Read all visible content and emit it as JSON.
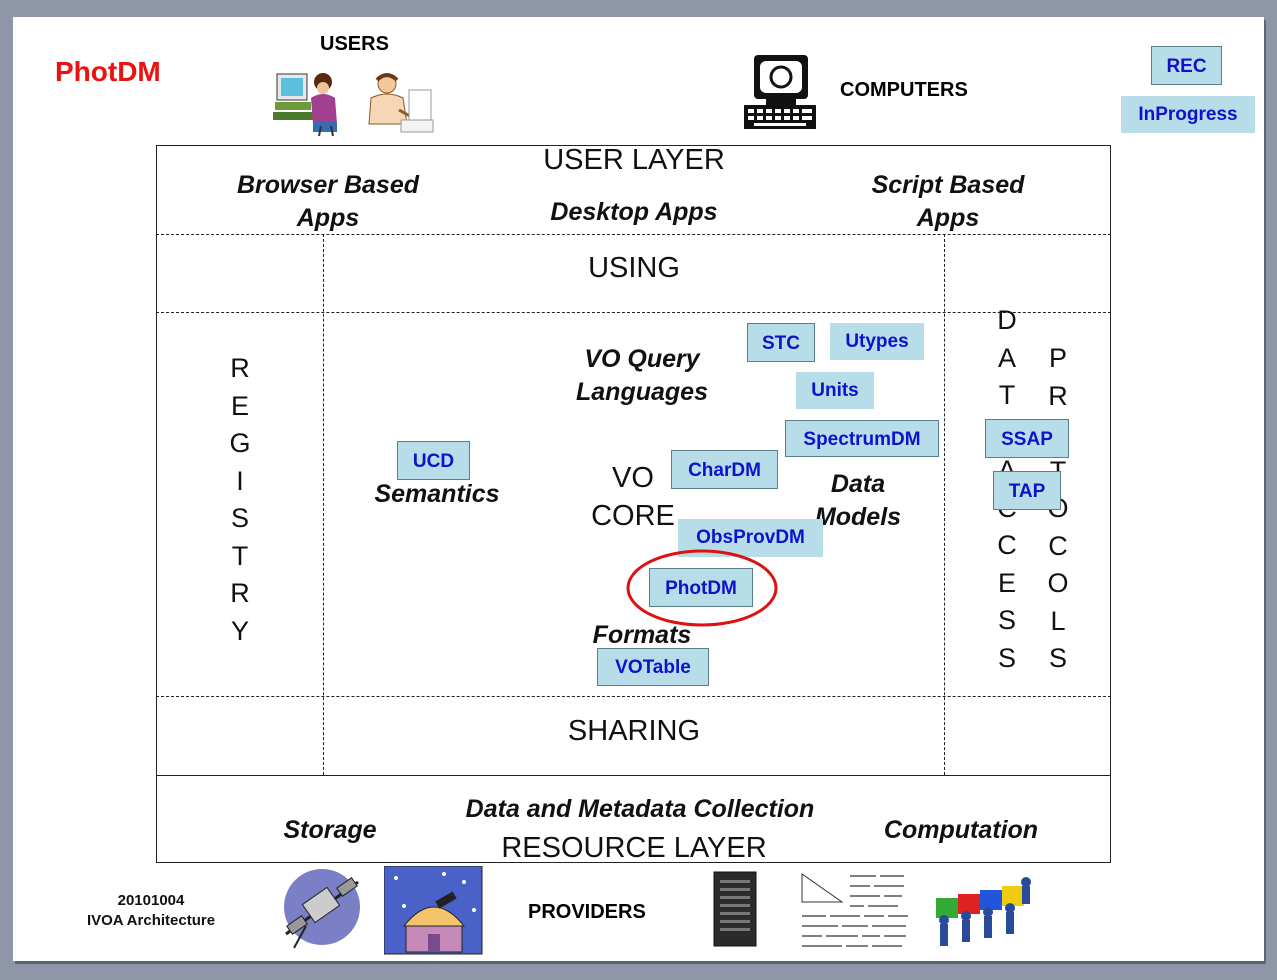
{
  "title": "PhotDM",
  "legend": {
    "rec": "REC",
    "in_progress": "InProgress"
  },
  "top": {
    "users": "USERS",
    "computers": "COMPUTERS"
  },
  "user_layer": {
    "label": "USER LAYER",
    "browser": [
      "Browser Based",
      "Apps"
    ],
    "desktop": "Desktop Apps",
    "script": [
      "Script Based",
      "Apps"
    ]
  },
  "using": "USING",
  "sharing": "SHARING",
  "registry": [
    "R",
    "E",
    "G",
    "I",
    "S",
    "T",
    "R",
    "Y"
  ],
  "data_access": [
    "D",
    "A",
    "T",
    "A",
    "A",
    "C",
    "C",
    "E",
    "S",
    "S"
  ],
  "protocols": [
    "P",
    "R",
    "O",
    "T",
    "O",
    "C",
    "O",
    "L",
    "S"
  ],
  "center": {
    "vo_query": [
      "VO Query",
      "Languages"
    ],
    "semantics": "Semantics",
    "vo_core": [
      "VO",
      "CORE"
    ],
    "data_models": [
      "Data",
      "Models"
    ],
    "formats": "Formats"
  },
  "standards": {
    "stc": "STC",
    "utypes": "Utypes",
    "units": "Units",
    "spectrumdm": "SpectrumDM",
    "ucd": "UCD",
    "chardm": "CharDM",
    "obsprovdm": "ObsProvDM",
    "photdm": "PhotDM",
    "votable": "VOTable",
    "ssap": "SSAP",
    "tap": "TAP"
  },
  "resource_layer": {
    "storage": "Storage",
    "collection": "Data and Metadata Collection",
    "computation": "Computation",
    "label": "RESOURCE LAYER"
  },
  "footer": {
    "date": "20101004",
    "doc": "IVOA Architecture",
    "providers": "PROVIDERS"
  },
  "colors": {
    "title": "#ee1111",
    "box_fill": "#b7dde8",
    "box_text": "#1111cc",
    "highlight": "#dd1111"
  }
}
